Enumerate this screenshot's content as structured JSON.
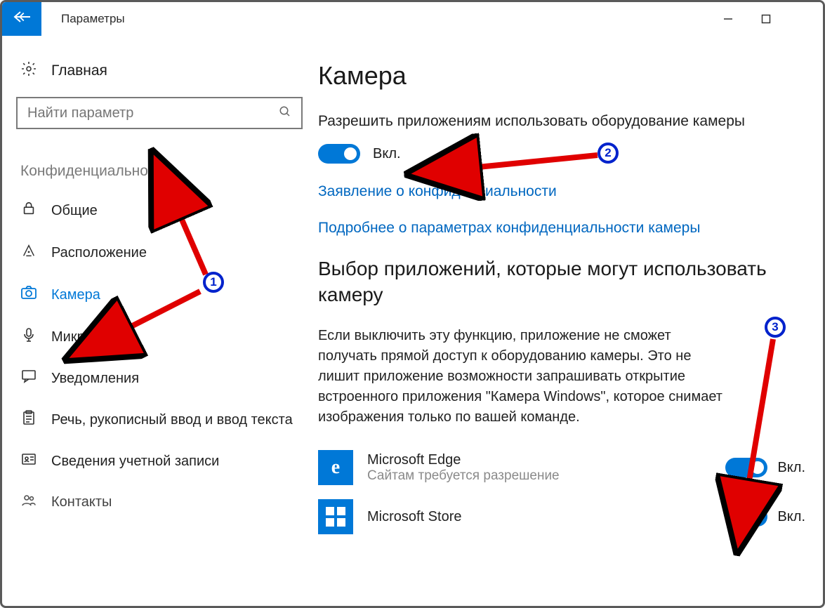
{
  "titlebar": {
    "app_title": "Параметры"
  },
  "sidebar": {
    "home_label": "Главная",
    "search_placeholder": "Найти параметр",
    "section_header": "Конфиденциальность",
    "items": [
      {
        "icon": "lock-icon",
        "glyph": "🔒",
        "label": "Общие",
        "active": false
      },
      {
        "icon": "location-icon",
        "glyph": "⎈",
        "label": "Расположение",
        "active": false
      },
      {
        "icon": "camera-icon",
        "glyph": "📷",
        "label": "Камера",
        "active": true
      },
      {
        "icon": "microphone-icon",
        "glyph": "🎤",
        "label": "Микрофон",
        "active": false
      },
      {
        "icon": "notifications-icon",
        "glyph": "💬",
        "label": "Уведомления",
        "active": false
      },
      {
        "icon": "speech-icon",
        "glyph": "📋",
        "label": "Речь, рукописный ввод и ввод текста",
        "active": false
      },
      {
        "icon": "account-icon",
        "glyph": "⧉",
        "label": "Сведения учетной записи",
        "active": false
      },
      {
        "icon": "contacts-icon",
        "glyph": "👥",
        "label": "Контакты",
        "active": false
      }
    ]
  },
  "main": {
    "page_title": "Камера",
    "allow_heading": "Разрешить приложениям использовать оборудование камеры",
    "toggle_main_label": "Вкл.",
    "link_privacy": "Заявление о конфиденциальности",
    "link_learn": "Подробнее о параметрах конфиденциальности камеры",
    "section2_title": "Выбор приложений, которые могут использовать камеру",
    "section2_body": "Если выключить эту функцию, приложение не сможет получать прямой доступ к оборудованию камеры. Это не лишит приложение возможности запрашивать открытие встроенного приложения \"Камера Windows\", которое снимает изображения только по вашей команде.",
    "apps": [
      {
        "name": "Microsoft Edge",
        "sub": "Сайтам требуется разрешение",
        "toggle_label": "Вкл.",
        "icon": "edge"
      },
      {
        "name": "Microsoft Store",
        "sub": "",
        "toggle_label": "Вкл.",
        "icon": "store"
      }
    ]
  },
  "annotations": {
    "badge1": "1",
    "badge2": "2",
    "badge3": "3"
  }
}
